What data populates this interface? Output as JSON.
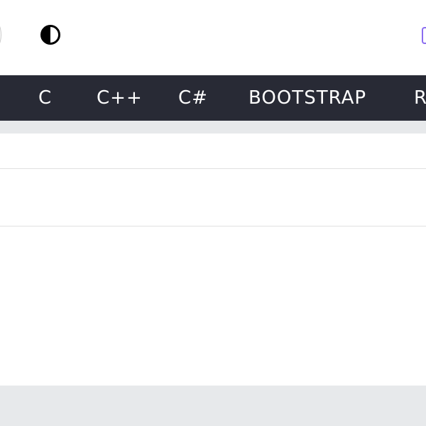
{
  "header": {
    "theme_toggle_icon": "contrast-icon",
    "edge_icon": "partial-bracket-icon",
    "accent_color": "#8b6df0"
  },
  "nav": {
    "background_color": "#282a35",
    "items": [
      {
        "label": "C"
      },
      {
        "label": "C++"
      },
      {
        "label": "C#"
      },
      {
        "label": "BOOTSTRAP"
      },
      {
        "label": "R"
      }
    ]
  },
  "colors": {
    "page_background": "#ffffff",
    "subbar_background": "#e7e9eb",
    "divider": "#e0e0e0"
  }
}
